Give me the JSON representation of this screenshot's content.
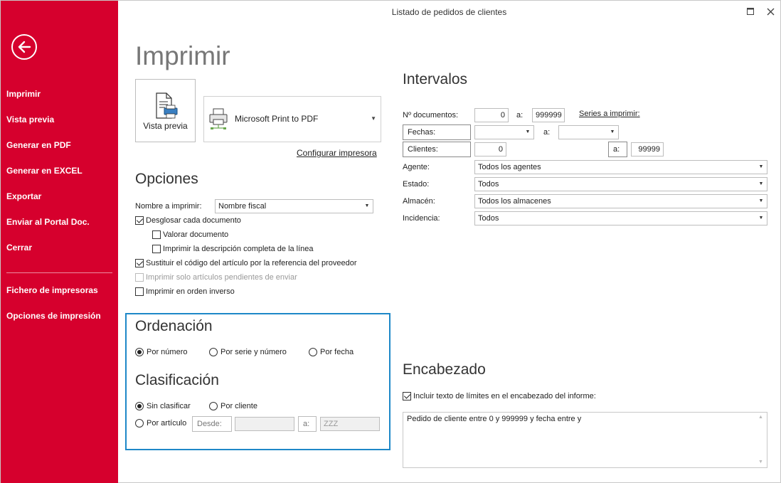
{
  "window": {
    "title": "Listado de pedidos de clientes"
  },
  "sidebar": {
    "items": [
      {
        "label": "Imprimir"
      },
      {
        "label": "Vista previa"
      },
      {
        "label": "Generar en PDF"
      },
      {
        "label": "Generar en EXCEL"
      },
      {
        "label": "Exportar"
      },
      {
        "label": "Enviar al Portal Doc."
      },
      {
        "label": "Cerrar"
      }
    ],
    "secondary_items": [
      {
        "label": "Fichero de impresoras"
      },
      {
        "label": "Opciones de impresión"
      }
    ]
  },
  "print": {
    "heading": "Imprimir",
    "preview_label": "Vista previa",
    "printer_name": "Microsoft Print to PDF",
    "configure_link": "Configurar impresora"
  },
  "options": {
    "heading": "Opciones",
    "name_label": "Nombre a imprimir:",
    "name_value": "Nombre fiscal",
    "checks": [
      {
        "label": "Desglosar cada documento",
        "checked": true
      },
      {
        "label": "Valorar documento",
        "checked": false
      },
      {
        "label": "Imprimir la descripción completa de la línea",
        "checked": false
      },
      {
        "label": "Sustituir el código del artículo por la referencia del proveedor",
        "checked": true
      },
      {
        "label": "Imprimir solo artículos pendientes de enviar",
        "checked": false,
        "disabled": true
      },
      {
        "label": "Imprimir en orden inverso",
        "checked": false
      }
    ]
  },
  "ordenacion": {
    "heading": "Ordenación",
    "options": [
      {
        "label": "Por número",
        "selected": true
      },
      {
        "label": "Por serie y número",
        "selected": false
      },
      {
        "label": "Por fecha",
        "selected": false
      }
    ]
  },
  "clasificacion": {
    "heading": "Clasificación",
    "options": [
      {
        "label": "Sin clasificar",
        "selected": true
      },
      {
        "label": "Por cliente",
        "selected": false
      },
      {
        "label": "Por artículo",
        "selected": false
      }
    ],
    "desde_label": "Desde:",
    "a_label": "a:",
    "hasta_value": "ZZZ"
  },
  "intervalos": {
    "heading": "Intervalos",
    "doc_label": "Nº documentos:",
    "doc_from": "0",
    "a_label": "a:",
    "doc_to": "999999",
    "series_link": "Series a imprimir:",
    "fechas_label": "Fechas:",
    "clientes_label": "Clientes:",
    "clientes_from": "0",
    "clientes_to": "99999",
    "agente_label": "Agente:",
    "agente_value": "Todos los agentes",
    "estado_label": "Estado:",
    "estado_value": "Todos",
    "almacen_label": "Almacén:",
    "almacen_value": "Todos los almacenes",
    "incidencia_label": "Incidencia:",
    "incidencia_value": "Todos"
  },
  "encabezado": {
    "heading": "Encabezado",
    "check_label": "Incluir texto de límites en el encabezado del informe:",
    "checked": true,
    "text": "Pedido de cliente entre 0 y 999999 y fecha entre  y"
  },
  "colors": {
    "sidebar": "#d6002d",
    "group_border": "#1e88c8"
  }
}
